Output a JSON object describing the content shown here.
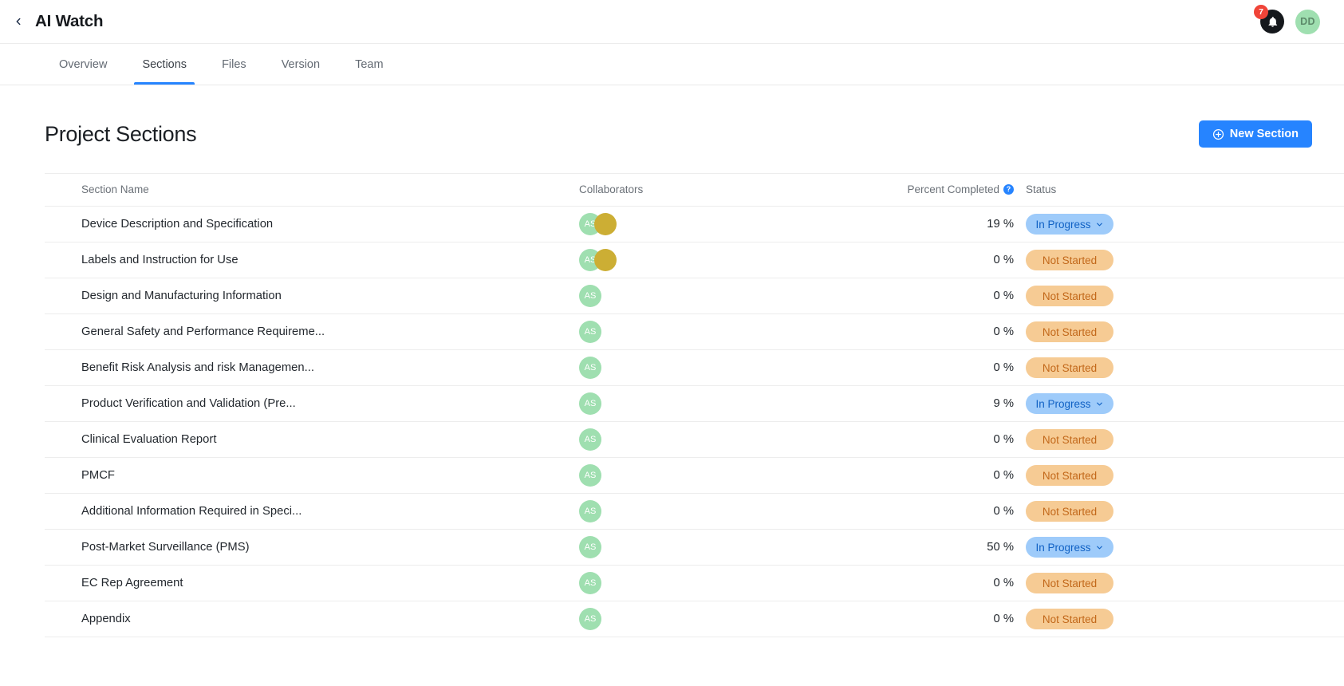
{
  "topbar": {
    "back_icon": "chevron-left-icon",
    "title": "AI Watch",
    "notification": {
      "icon": "bell-icon",
      "badge_count": "7"
    },
    "avatar": {
      "initials": "DD"
    }
  },
  "tabs": [
    {
      "label": "Overview",
      "active": false
    },
    {
      "label": "Sections",
      "active": true
    },
    {
      "label": "Files",
      "active": false
    },
    {
      "label": "Version",
      "active": false
    },
    {
      "label": "Team",
      "active": false
    }
  ],
  "page": {
    "title": "Project Sections",
    "new_section_label": "New Section",
    "new_section_icon": "plus-circle-icon"
  },
  "table": {
    "headers": {
      "name": "Section Name",
      "collaborators": "Collaborators",
      "percent": "Percent Completed",
      "percent_help_icon": "help-icon",
      "status": "Status"
    },
    "rows": [
      {
        "name": "Device Description and Specification",
        "collaborators": [
          "AS",
          ""
        ],
        "percent": "19 %",
        "status": "In Progress",
        "status_type": "inprogress"
      },
      {
        "name": "Labels and Instruction for Use",
        "collaborators": [
          "AS",
          ""
        ],
        "percent": "0 %",
        "status": "Not Started",
        "status_type": "notstarted"
      },
      {
        "name": "Design and Manufacturing Information",
        "collaborators": [
          "AS"
        ],
        "percent": "0 %",
        "status": "Not Started",
        "status_type": "notstarted"
      },
      {
        "name": "General Safety and Performance Requireme...",
        "collaborators": [
          "AS"
        ],
        "percent": "0 %",
        "status": "Not Started",
        "status_type": "notstarted"
      },
      {
        "name": "Benefit Risk Analysis and risk Managemen...",
        "collaborators": [
          "AS"
        ],
        "percent": "0 %",
        "status": "Not Started",
        "status_type": "notstarted"
      },
      {
        "name": "Product Verification and Validation (Pre...",
        "collaborators": [
          "AS"
        ],
        "percent": "9 %",
        "status": "In Progress",
        "status_type": "inprogress"
      },
      {
        "name": "Clinical Evaluation Report",
        "collaborators": [
          "AS"
        ],
        "percent": "0 %",
        "status": "Not Started",
        "status_type": "notstarted"
      },
      {
        "name": "PMCF",
        "collaborators": [
          "AS"
        ],
        "percent": "0 %",
        "status": "Not Started",
        "status_type": "notstarted"
      },
      {
        "name": "Additional Information Required in Speci...",
        "collaborators": [
          "AS"
        ],
        "percent": "0 %",
        "status": "Not Started",
        "status_type": "notstarted"
      },
      {
        "name": "Post-Market Surveillance (PMS)",
        "collaborators": [
          "AS"
        ],
        "percent": "50 %",
        "status": "In Progress",
        "status_type": "inprogress"
      },
      {
        "name": "EC Rep Agreement",
        "collaborators": [
          "AS"
        ],
        "percent": "0 %",
        "status": "Not Started",
        "status_type": "notstarted"
      },
      {
        "name": "Appendix",
        "collaborators": [
          "AS"
        ],
        "percent": "0 %",
        "status": "Not Started",
        "status_type": "notstarted"
      }
    ]
  },
  "colors": {
    "accent": "#2684ff",
    "badge_red": "#f04438",
    "avatar_green": "#9fdfb0",
    "avatar_gold": "#ccae34",
    "inprogress_bg": "#9ecbfa",
    "inprogress_text": "#1061c4",
    "notstarted_bg": "#f6cb94",
    "notstarted_text": "#c2681a"
  }
}
